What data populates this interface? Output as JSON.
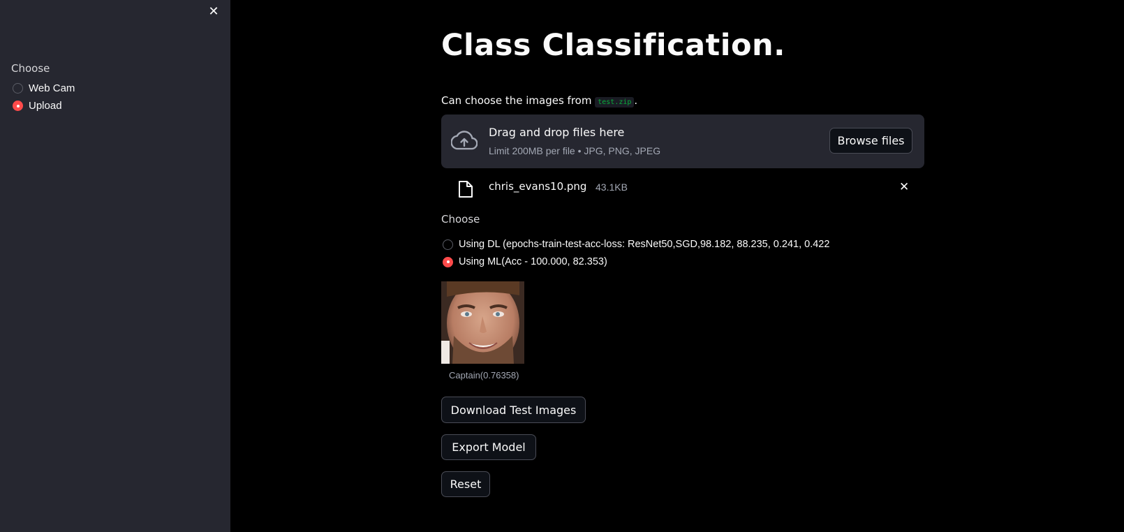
{
  "sidebar": {
    "close_glyph": "✕",
    "heading": "Choose",
    "options": [
      {
        "label": "Web Cam",
        "selected": false
      },
      {
        "label": "Upload",
        "selected": true
      }
    ]
  },
  "main": {
    "title": "Class Classification.",
    "hint_prefix": "Can choose the images from ",
    "hint_code": "test.zip",
    "hint_suffix": ".",
    "uploader": {
      "icon": "cloud-upload-icon",
      "title": "Drag and drop files here",
      "subtitle": "Limit 200MB per file • JPG, PNG, JPEG",
      "browse_label": "Browse files"
    },
    "file": {
      "icon": "file-icon",
      "name": "chris_evans10.png",
      "size": "43.1KB",
      "remove_glyph": "✕"
    },
    "model_choice": {
      "heading": "Choose",
      "options": [
        {
          "label": "Using DL (epochs-train-test-acc-loss: ResNet50,SGD,98.182, 88.235, 0.241, 0.422",
          "selected": false
        },
        {
          "label": "Using ML(Acc - 100.000, 82.353)",
          "selected": true
        }
      ]
    },
    "result": {
      "caption": "Captain(0.76358)"
    },
    "buttons": {
      "download": "Download Test Images",
      "export": "Export Model",
      "reset": "Reset"
    }
  },
  "colors": {
    "sidebar_bg": "#262730",
    "main_bg": "#000000",
    "accent": "#ff4b4b",
    "code_text": "#09ab3b"
  }
}
